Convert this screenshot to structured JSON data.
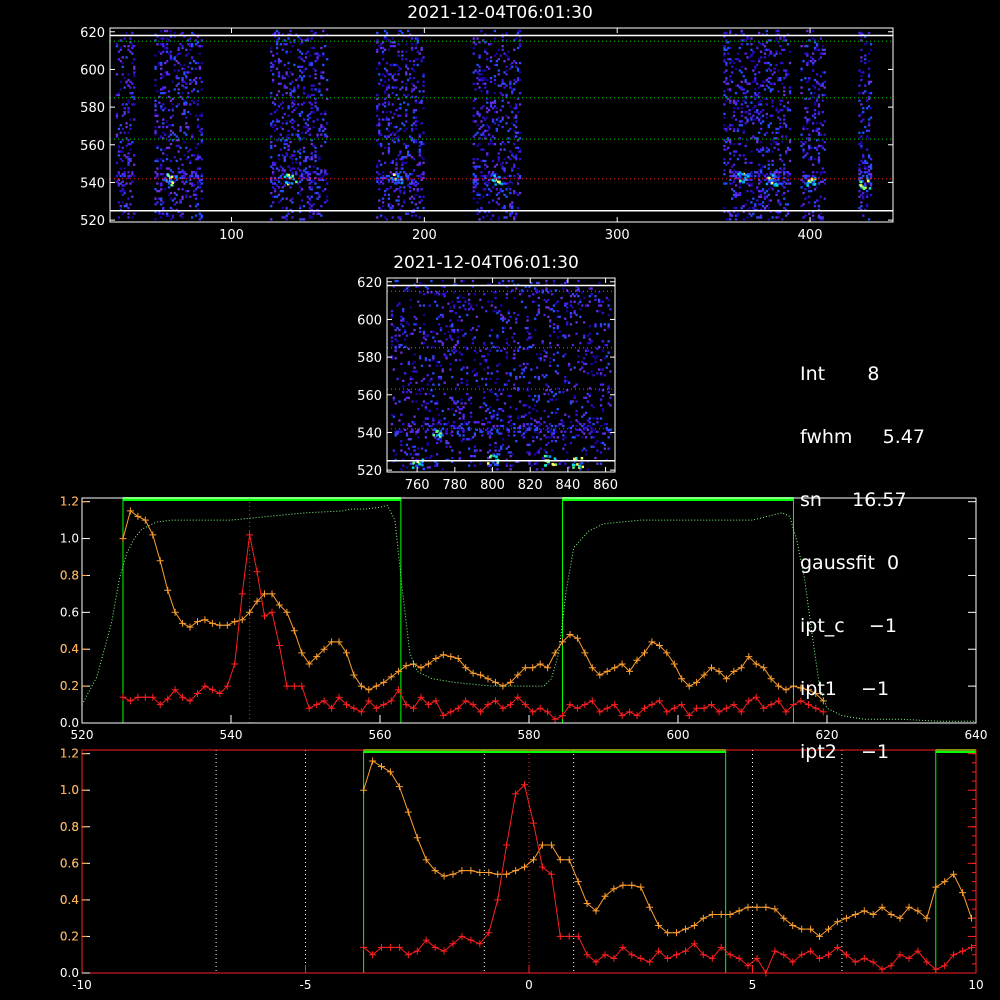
{
  "chart_data": [
    {
      "type": "heatmap",
      "title": "2021-12-04T06:01:30",
      "xlim": [
        37,
        443
      ],
      "ylim": [
        519,
        622
      ],
      "xticks": [
        100,
        200,
        300,
        400
      ],
      "yticks": [
        520,
        540,
        560,
        580,
        600,
        620
      ],
      "hlines": [
        {
          "y": 618,
          "color": "#ffffff",
          "style": "solid"
        },
        {
          "y": 615,
          "color": "#00d000",
          "style": "dotted"
        },
        {
          "y": 585,
          "color": "#00d000",
          "style": "dotted"
        },
        {
          "y": 563,
          "color": "#00d000",
          "style": "dotted"
        },
        {
          "y": 542,
          "color": "#ff2020",
          "style": "dotted"
        },
        {
          "y": 525,
          "color": "#ffffff",
          "style": "solid"
        }
      ],
      "bright_spots": [
        {
          "x": 68,
          "y": 542
        },
        {
          "x": 130,
          "y": 542
        },
        {
          "x": 185,
          "y": 542
        },
        {
          "x": 237,
          "y": 542
        },
        {
          "x": 365,
          "y": 543
        },
        {
          "x": 380,
          "y": 542
        },
        {
          "x": 400,
          "y": 542
        },
        {
          "x": 428,
          "y": 540
        }
      ],
      "pixel_columns": [
        {
          "x0": 40,
          "x1": 50
        },
        {
          "x0": 60,
          "x1": 85
        },
        {
          "x0": 120,
          "x1": 150
        },
        {
          "x0": 175,
          "x1": 200
        },
        {
          "x0": 225,
          "x1": 250
        },
        {
          "x0": 355,
          "x1": 390
        },
        {
          "x0": 395,
          "x1": 408
        },
        {
          "x0": 425,
          "x1": 432
        }
      ]
    },
    {
      "type": "heatmap",
      "title": "2021-12-04T06:01:30",
      "xlim": [
        744,
        865
      ],
      "ylim": [
        519,
        622
      ],
      "xticks": [
        760,
        780,
        800,
        820,
        840,
        860
      ],
      "yticks": [
        520,
        540,
        560,
        580,
        600,
        620
      ],
      "hlines": [
        {
          "y": 618,
          "color": "#ffffff",
          "style": "solid"
        },
        {
          "y": 615,
          "color": "#00d000",
          "style": "dotted"
        },
        {
          "y": 585,
          "color": "#00d000",
          "style": "dotted"
        },
        {
          "y": 563,
          "color": "#00d000",
          "style": "dotted"
        },
        {
          "y": 542,
          "color": "#ff2020",
          "style": "dotted"
        },
        {
          "y": 525,
          "color": "#ffffff",
          "style": "solid"
        }
      ],
      "bright_spots": [
        {
          "x": 760,
          "y": 524
        },
        {
          "x": 800,
          "y": 526
        },
        {
          "x": 830,
          "y": 526
        },
        {
          "x": 770,
          "y": 540
        },
        {
          "x": 845,
          "y": 525
        }
      ]
    },
    {
      "type": "line",
      "xlim": [
        520,
        640
      ],
      "ylim": [
        0,
        1.22
      ],
      "xticks": [
        520,
        540,
        560,
        580,
        600,
        620,
        640
      ],
      "yticks_left": [
        0.0,
        0.2,
        0.4,
        0.6,
        0.8,
        1.0,
        1.2
      ],
      "yticks_orange": [
        0.2,
        0.4,
        0.8,
        1.2
      ],
      "vline_red": 542.5,
      "green_boxes": [
        [
          525.5,
          562.8
        ],
        [
          584.5,
          615.5
        ]
      ],
      "series": [
        {
          "color": "#ffa030",
          "x": [
            525.5,
            526.5,
            527.5,
            528.5,
            529.5,
            530.5,
            531.5,
            532.5,
            533.5,
            534.5,
            535.5,
            536.5,
            537.5,
            538.5,
            539.5,
            540.5,
            541.5,
            542.5,
            543.5,
            544.5,
            545.5,
            546.5,
            547.5,
            548.5,
            549.5,
            550.5,
            551.5,
            552.5,
            553.5,
            554.5,
            555.5,
            556.5,
            557.5,
            558.5,
            559.5,
            560.5,
            561.5,
            562.5,
            563.5,
            564.5,
            565.5,
            566.5,
            567.5,
            568.5,
            569.5,
            570.5,
            571.5,
            572.5,
            573.5,
            574.5,
            575.5,
            576.5,
            577.5,
            578.5,
            579.5,
            580.5,
            581.5,
            582.5,
            583.5,
            584.5,
            585.5,
            586.5,
            587.5,
            588.5,
            589.5,
            590.5,
            591.5,
            592.5,
            593.5,
            594.5,
            595.5,
            596.5,
            597.5,
            598.5,
            599.5,
            600.5,
            601.5,
            602.5,
            603.5,
            604.5,
            605.5,
            606.5,
            607.5,
            608.5,
            609.5,
            610.5,
            611.5,
            612.5,
            613.5,
            614.5,
            615.5,
            616.5,
            617.5,
            618.5,
            619.5
          ],
          "y": [
            1.0,
            1.15,
            1.12,
            1.1,
            1.02,
            0.88,
            0.72,
            0.6,
            0.54,
            0.52,
            0.55,
            0.56,
            0.54,
            0.53,
            0.53,
            0.55,
            0.56,
            0.6,
            0.66,
            0.7,
            0.7,
            0.64,
            0.6,
            0.5,
            0.38,
            0.32,
            0.36,
            0.4,
            0.44,
            0.44,
            0.38,
            0.26,
            0.2,
            0.18,
            0.2,
            0.22,
            0.25,
            0.28,
            0.31,
            0.32,
            0.3,
            0.32,
            0.35,
            0.37,
            0.36,
            0.35,
            0.3,
            0.27,
            0.26,
            0.24,
            0.22,
            0.2,
            0.22,
            0.26,
            0.3,
            0.3,
            0.32,
            0.3,
            0.38,
            0.44,
            0.48,
            0.46,
            0.38,
            0.3,
            0.26,
            0.28,
            0.3,
            0.32,
            0.28,
            0.34,
            0.38,
            0.44,
            0.42,
            0.38,
            0.32,
            0.24,
            0.2,
            0.22,
            0.26,
            0.3,
            0.28,
            0.24,
            0.28,
            0.3,
            0.36,
            0.32,
            0.3,
            0.24,
            0.2,
            0.18,
            0.2,
            0.19,
            0.18,
            0.16,
            0.12
          ]
        },
        {
          "color": "#ff2020",
          "x": [
            525.5,
            526.5,
            527.5,
            528.5,
            529.5,
            530.5,
            531.5,
            532.5,
            533.5,
            534.5,
            535.5,
            536.5,
            537.5,
            538.5,
            539.5,
            540.5,
            541.5,
            542.5,
            543.5,
            544.5,
            545.5,
            546.5,
            547.5,
            548.5,
            549.5,
            550.5,
            551.5,
            552.5,
            553.5,
            554.5,
            555.5,
            556.5,
            557.5,
            558.5,
            559.5,
            560.5,
            561.5,
            562.5,
            563.5,
            564.5,
            565.5,
            566.5,
            567.5,
            568.5,
            569.5,
            570.5,
            571.5,
            572.5,
            573.5,
            574.5,
            575.5,
            576.5,
            577.5,
            578.5,
            579.5,
            580.5,
            581.5,
            582.5,
            583.5,
            584.5,
            585.5,
            586.5,
            587.5,
            588.5,
            589.5,
            590.5,
            591.5,
            592.5,
            593.5,
            594.5,
            595.5,
            596.5,
            597.5,
            598.5,
            599.5,
            600.5,
            601.5,
            602.5,
            603.5,
            604.5,
            605.5,
            606.5,
            607.5,
            608.5,
            609.5,
            610.5,
            611.5,
            612.5,
            613.5,
            614.5,
            615.5,
            616.5,
            617.5,
            618.5,
            619.5
          ],
          "y": [
            0.14,
            0.12,
            0.14,
            0.14,
            0.14,
            0.1,
            0.13,
            0.18,
            0.14,
            0.12,
            0.16,
            0.2,
            0.18,
            0.16,
            0.2,
            0.32,
            0.7,
            1.02,
            0.82,
            0.58,
            0.6,
            0.42,
            0.2,
            0.2,
            0.2,
            0.08,
            0.1,
            0.12,
            0.08,
            0.14,
            0.1,
            0.08,
            0.06,
            0.12,
            0.08,
            0.1,
            0.12,
            0.18,
            0.1,
            0.08,
            0.14,
            0.1,
            0.12,
            0.04,
            0.06,
            0.08,
            0.12,
            0.1,
            0.06,
            0.1,
            0.12,
            0.08,
            0.1,
            0.14,
            0.1,
            0.06,
            0.08,
            0.06,
            0.02,
            0.04,
            0.1,
            0.08,
            0.1,
            0.12,
            0.06,
            0.08,
            0.1,
            0.04,
            0.06,
            0.04,
            0.08,
            0.1,
            0.12,
            0.06,
            0.08,
            0.1,
            0.04,
            0.08,
            0.08,
            0.1,
            0.06,
            0.08,
            0.1,
            0.06,
            0.12,
            0.14,
            0.08,
            0.1,
            0.12,
            0.06,
            0.1,
            0.12,
            0.1,
            0.08,
            0.06
          ]
        },
        {
          "color": "#80ff80",
          "x": [
            520,
            522,
            524,
            525,
            526,
            527,
            528,
            530,
            532,
            535,
            540,
            545,
            550,
            555,
            556,
            558,
            560,
            561,
            562,
            563,
            564,
            565,
            567,
            570,
            575,
            580,
            582,
            583,
            584,
            585,
            586,
            588,
            590,
            595,
            600,
            605,
            610,
            612,
            614,
            615,
            616,
            617,
            618,
            619,
            620,
            622,
            625,
            630,
            635,
            640
          ],
          "y": [
            0.1,
            0.25,
            0.55,
            0.78,
            0.92,
            1.0,
            1.05,
            1.09,
            1.1,
            1.1,
            1.1,
            1.12,
            1.14,
            1.15,
            1.16,
            1.16,
            1.17,
            1.18,
            1.1,
            0.72,
            0.38,
            0.28,
            0.24,
            0.22,
            0.2,
            0.2,
            0.2,
            0.24,
            0.38,
            0.72,
            0.95,
            1.04,
            1.08,
            1.1,
            1.1,
            1.1,
            1.1,
            1.12,
            1.14,
            1.12,
            0.98,
            0.78,
            0.48,
            0.2,
            0.08,
            0.04,
            0.02,
            0.02,
            0.01,
            0.01
          ]
        }
      ]
    },
    {
      "type": "line",
      "xlim": [
        -10,
        10
      ],
      "ylim": [
        0,
        1.22
      ],
      "xticks": [
        -10,
        -5,
        0,
        5,
        10
      ],
      "yticks_left": [
        0.0,
        0.2,
        0.4,
        0.6,
        0.8,
        1.0,
        1.2
      ],
      "yticks_orange": [
        0.2,
        0.4,
        0.6,
        0.8,
        1.0,
        1.2
      ],
      "vline_red": 0,
      "vlines_white": [
        -7,
        -5,
        -1,
        1,
        5,
        7
      ],
      "green_boxes": [
        [
          -3.7,
          4.4
        ],
        [
          9.1,
          10.0
        ]
      ],
      "series": [
        {
          "color": "#ffa030",
          "x": [
            -3.7,
            -3.5,
            -3.3,
            -3.1,
            -2.9,
            -2.7,
            -2.5,
            -2.3,
            -2.1,
            -1.9,
            -1.7,
            -1.5,
            -1.3,
            -1.1,
            -0.9,
            -0.7,
            -0.5,
            -0.3,
            -0.1,
            0.1,
            0.3,
            0.5,
            0.7,
            0.9,
            1.1,
            1.3,
            1.5,
            1.7,
            1.9,
            2.1,
            2.3,
            2.5,
            2.7,
            2.9,
            3.1,
            3.3,
            3.5,
            3.7,
            3.9,
            4.1,
            4.3,
            4.5,
            4.7,
            4.9,
            5.1,
            5.3,
            5.5,
            5.7,
            5.9,
            6.1,
            6.3,
            6.5,
            6.7,
            6.9,
            7.1,
            7.3,
            7.5,
            7.7,
            7.9,
            8.1,
            8.3,
            8.5,
            8.7,
            8.9,
            9.1,
            9.3,
            9.5,
            9.7,
            9.9
          ],
          "y": [
            1.0,
            1.16,
            1.13,
            1.1,
            1.02,
            0.88,
            0.74,
            0.62,
            0.56,
            0.53,
            0.54,
            0.56,
            0.56,
            0.55,
            0.55,
            0.54,
            0.54,
            0.56,
            0.58,
            0.62,
            0.7,
            0.7,
            0.62,
            0.62,
            0.5,
            0.38,
            0.34,
            0.42,
            0.46,
            0.48,
            0.48,
            0.47,
            0.36,
            0.26,
            0.22,
            0.22,
            0.24,
            0.26,
            0.3,
            0.32,
            0.32,
            0.32,
            0.34,
            0.36,
            0.36,
            0.36,
            0.35,
            0.3,
            0.26,
            0.24,
            0.24,
            0.2,
            0.24,
            0.28,
            0.3,
            0.32,
            0.34,
            0.32,
            0.36,
            0.32,
            0.3,
            0.36,
            0.34,
            0.3,
            0.47,
            0.5,
            0.54,
            0.44,
            0.3
          ]
        },
        {
          "color": "#ff2020",
          "x": [
            -3.7,
            -3.5,
            -3.3,
            -3.1,
            -2.9,
            -2.7,
            -2.5,
            -2.3,
            -2.1,
            -1.9,
            -1.7,
            -1.5,
            -1.3,
            -1.1,
            -0.9,
            -0.7,
            -0.5,
            -0.3,
            -0.1,
            0.1,
            0.3,
            0.5,
            0.7,
            0.9,
            1.1,
            1.3,
            1.5,
            1.7,
            1.9,
            2.1,
            2.3,
            2.5,
            2.7,
            2.9,
            3.1,
            3.3,
            3.5,
            3.7,
            3.9,
            4.1,
            4.3,
            4.5,
            4.7,
            4.9,
            5.1,
            5.3,
            5.5,
            5.7,
            5.9,
            6.1,
            6.3,
            6.5,
            6.7,
            6.9,
            7.1,
            7.3,
            7.5,
            7.7,
            7.9,
            8.1,
            8.3,
            8.5,
            8.7,
            8.9,
            9.1,
            9.3,
            9.5,
            9.7,
            9.9
          ],
          "y": [
            0.14,
            0.1,
            0.14,
            0.14,
            0.14,
            0.1,
            0.12,
            0.18,
            0.14,
            0.12,
            0.16,
            0.2,
            0.18,
            0.16,
            0.22,
            0.4,
            0.7,
            0.98,
            1.03,
            0.82,
            0.58,
            0.54,
            0.2,
            0.2,
            0.2,
            0.1,
            0.06,
            0.1,
            0.08,
            0.14,
            0.1,
            0.08,
            0.06,
            0.12,
            0.08,
            0.1,
            0.12,
            0.16,
            0.1,
            0.08,
            0.14,
            0.1,
            0.08,
            0.04,
            0.08,
            0.0,
            0.12,
            0.1,
            0.06,
            0.1,
            0.12,
            0.08,
            0.1,
            0.14,
            0.1,
            0.06,
            0.08,
            0.06,
            0.02,
            0.04,
            0.1,
            0.08,
            0.12,
            0.06,
            0.02,
            0.04,
            0.1,
            0.12,
            0.14
          ]
        }
      ]
    }
  ],
  "info": {
    "lines": [
      "Int       8",
      "fwhm     5.47",
      "sn     16.57",
      "gaussfit  0",
      "ipt_c    −1",
      "ipt1    −1",
      "ipt2    −1"
    ]
  },
  "colors": {
    "axis": "#ffffff",
    "orange": "#ffa030",
    "red": "#ff2020",
    "green": "#00ff00",
    "ltgreen": "#80ff80"
  }
}
